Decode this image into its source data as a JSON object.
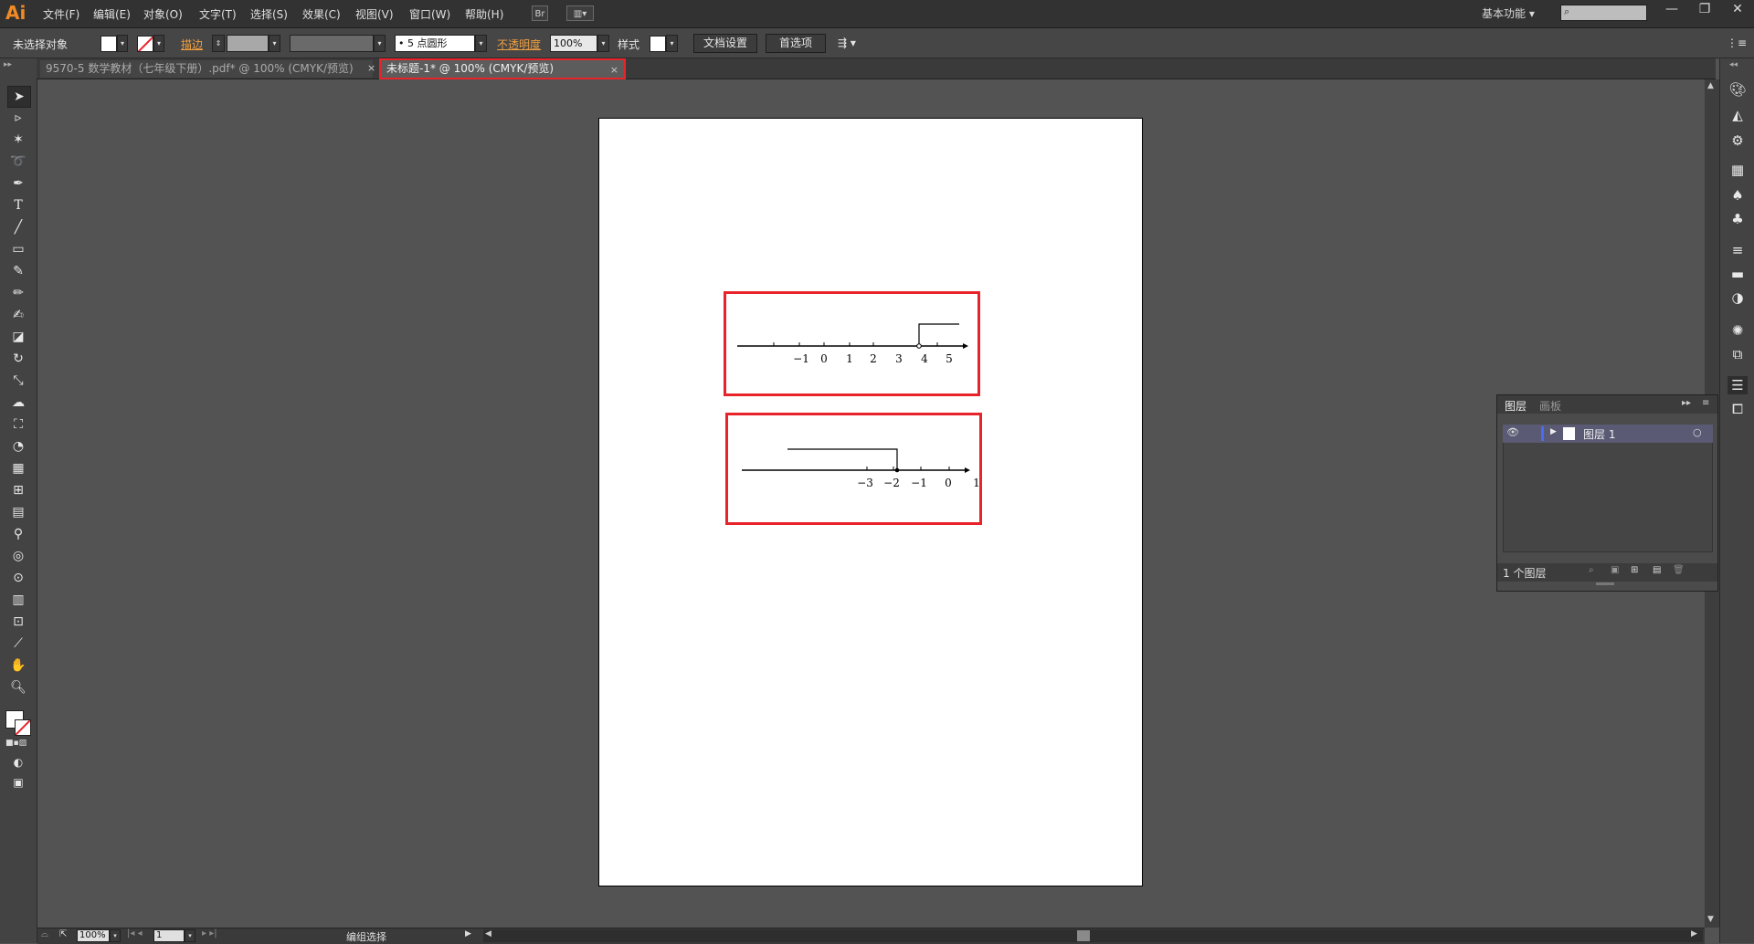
{
  "app": {
    "logo": "Ai"
  },
  "menu": {
    "items": [
      "文件(F)",
      "编辑(E)",
      "对象(O)",
      "文字(T)",
      "选择(S)",
      "效果(C)",
      "视图(V)",
      "窗口(W)",
      "帮助(H)"
    ],
    "bridge_label": "Br",
    "workspace": "基本功能"
  },
  "window_controls": {
    "minimize": "—",
    "restore": "❐",
    "close": "✕"
  },
  "control_bar": {
    "selection_status": "未选择对象",
    "stroke_label": "描边",
    "brush_value": "5 点圆形",
    "opacity_label": "不透明度",
    "opacity_value": "100%",
    "style_label": "样式",
    "doc_setup_button": "文档设置",
    "preferences_button": "首选项"
  },
  "tabs": [
    {
      "label": "9570-5 数学教材（七年级下册）.pdf* @ 100% (CMYK/预览)",
      "close": "×",
      "active": false
    },
    {
      "label": "未标题-1* @ 100% (CMYK/预览)",
      "close": "×",
      "active": true
    }
  ],
  "tools": [
    "selection-tool",
    "direct-selection-tool",
    "magic-wand-tool",
    "lasso-tool",
    "pen-tool",
    "type-tool",
    "line-tool",
    "rectangle-tool",
    "paintbrush-tool",
    "pencil-tool",
    "blob-brush-tool",
    "eraser-tool",
    "rotate-tool",
    "scale-tool",
    "warp-tool",
    "free-transform-tool",
    "shape-builder-tool",
    "perspective-grid-tool",
    "mesh-tool",
    "gradient-tool",
    "eyedropper-tool",
    "blend-tool",
    "symbol-sprayer-tool",
    "column-graph-tool",
    "artboard-tool",
    "slice-tool",
    "hand-tool",
    "zoom-tool"
  ],
  "number_lines": {
    "top": {
      "labels": [
        "−1",
        "0",
        "1",
        "2",
        "3",
        "4",
        "5"
      ]
    },
    "bottom": {
      "labels": [
        "−3",
        "−2",
        "−1",
        "0",
        "1"
      ]
    }
  },
  "layers_panel": {
    "tab_layers": "图层",
    "tab_artboards": "画板",
    "layer_name": "图层 1",
    "footer_count": "1 个图层"
  },
  "status_bar": {
    "zoom": "100%",
    "page": "1",
    "status_text": "编组选择"
  },
  "colors": {
    "highlight": "#e8232a",
    "link": "#f0a040",
    "bg": "#535353"
  }
}
